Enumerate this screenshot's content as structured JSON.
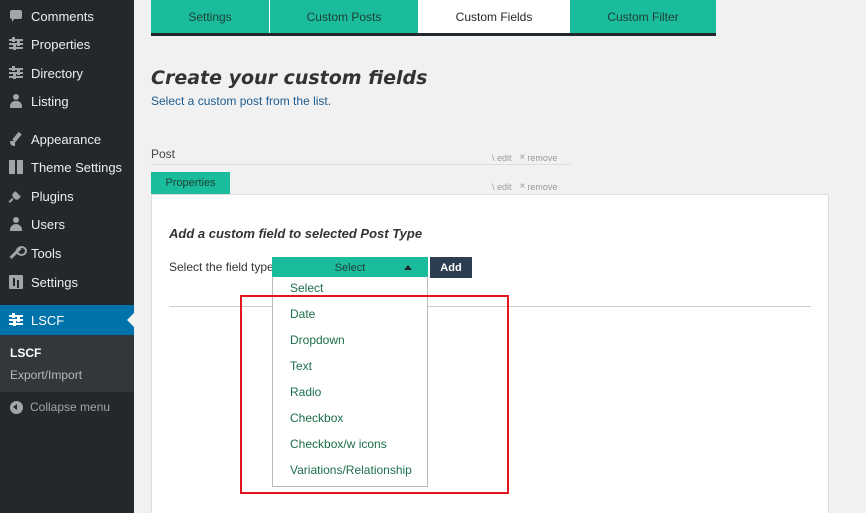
{
  "sidebar": {
    "items": [
      {
        "label": "Comments",
        "icon": "comments-icon"
      },
      {
        "label": "Properties",
        "icon": "sliders-icon"
      },
      {
        "label": "Directory",
        "icon": "sliders-icon"
      },
      {
        "label": "Listing",
        "icon": "group-icon"
      },
      {
        "label": "Appearance",
        "icon": "brush-icon"
      },
      {
        "label": "Theme Settings",
        "icon": "grid-icon"
      },
      {
        "label": "Plugins",
        "icon": "plugin-icon"
      },
      {
        "label": "Users",
        "icon": "user-icon"
      },
      {
        "label": "Tools",
        "icon": "wrench-icon"
      },
      {
        "label": "Settings",
        "icon": "settings-icon"
      },
      {
        "label": "LSCF",
        "icon": "sliders-icon"
      }
    ],
    "submenu": [
      "LSCF",
      "Export/Import"
    ],
    "collapse_label": "Collapse menu"
  },
  "tabs": [
    "Settings",
    "Custom Posts",
    "Custom Fields",
    "Custom Filter"
  ],
  "active_tab": "Custom Fields",
  "page": {
    "title": "Create your custom fields",
    "subtitle": "Select a custom post from the list."
  },
  "post_section": {
    "label": "Post",
    "edit": "edit",
    "remove": "remove",
    "selected_post": "Properties"
  },
  "panel": {
    "title": "Add a custom field to selected Post Type",
    "field_label": "Select the field type",
    "select_value": "Select",
    "add_label": "Add"
  },
  "dropdown": {
    "options": [
      "Select",
      "Date",
      "Dropdown",
      "Text",
      "Radio",
      "Checkbox",
      "Checkbox/w icons",
      "Variations/Relationship"
    ]
  },
  "colors": {
    "accent": "#1abc9c",
    "sidebar_bg": "#23282d",
    "active_menu": "#0073aa",
    "highlight": "#e2171d",
    "dark_button": "#2c3e50"
  }
}
